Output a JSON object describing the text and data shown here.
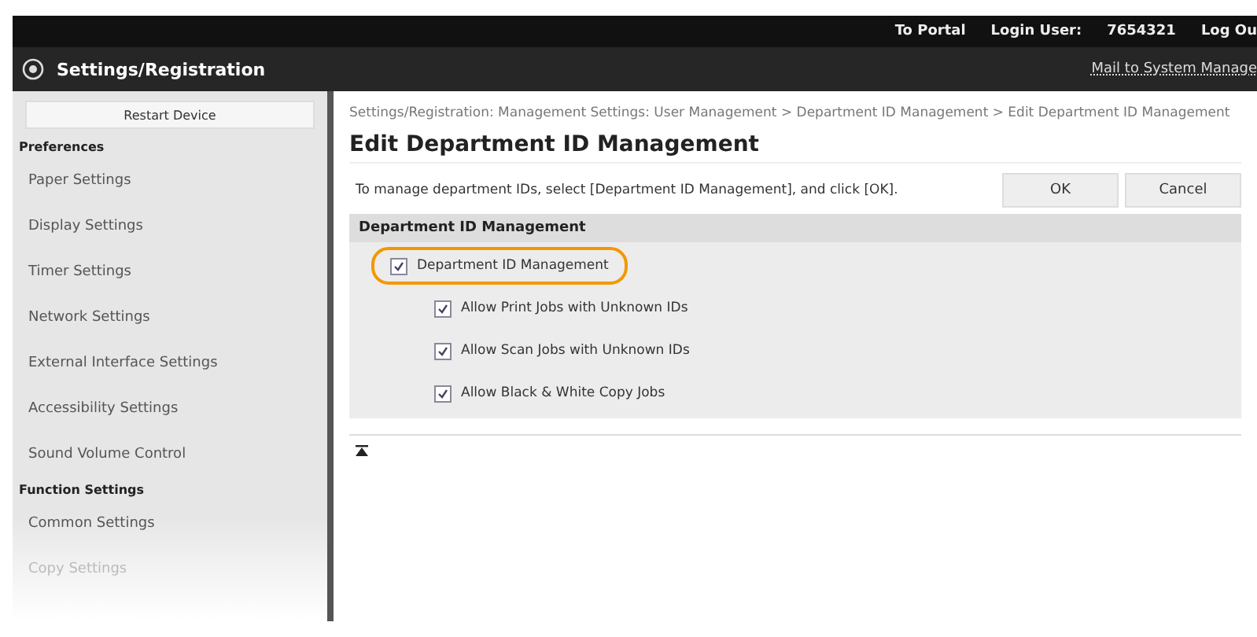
{
  "top_bar": {
    "links": [
      "To Portal"
    ],
    "login_label": "Login User:",
    "login_user": "7654321",
    "logout": "Log Ou"
  },
  "header": {
    "title": "Settings/Registration",
    "mail_link": "Mail to System Manage"
  },
  "sidebar": {
    "restart_button": "Restart Device",
    "sections": [
      {
        "heading": "Preferences",
        "items": [
          "Paper Settings",
          "Display Settings",
          "Timer Settings",
          "Network Settings",
          "External Interface Settings",
          "Accessibility Settings",
          "Sound Volume Control"
        ]
      },
      {
        "heading": "Function Settings",
        "items": [
          "Common Settings",
          "Copy Settings"
        ]
      }
    ]
  },
  "breadcrumb": "Settings/Registration: Management Settings: User Management > Department ID Management > Edit Department ID Management",
  "page_title": "Edit Department ID Management",
  "instruction": "To manage department IDs, select [Department ID Management], and click [OK].",
  "buttons": [
    "OK",
    "Cancel"
  ],
  "panel": {
    "heading": "Department ID Management",
    "options": [
      {
        "label": "Department ID Management",
        "checked": true,
        "highlighted": true,
        "children": [
          {
            "label": "Allow Print Jobs with Unknown IDs",
            "checked": true
          },
          {
            "label": "Allow Scan Jobs with Unknown IDs",
            "checked": true
          },
          {
            "label": "Allow Black & White Copy Jobs",
            "checked": true
          }
        ]
      }
    ]
  }
}
